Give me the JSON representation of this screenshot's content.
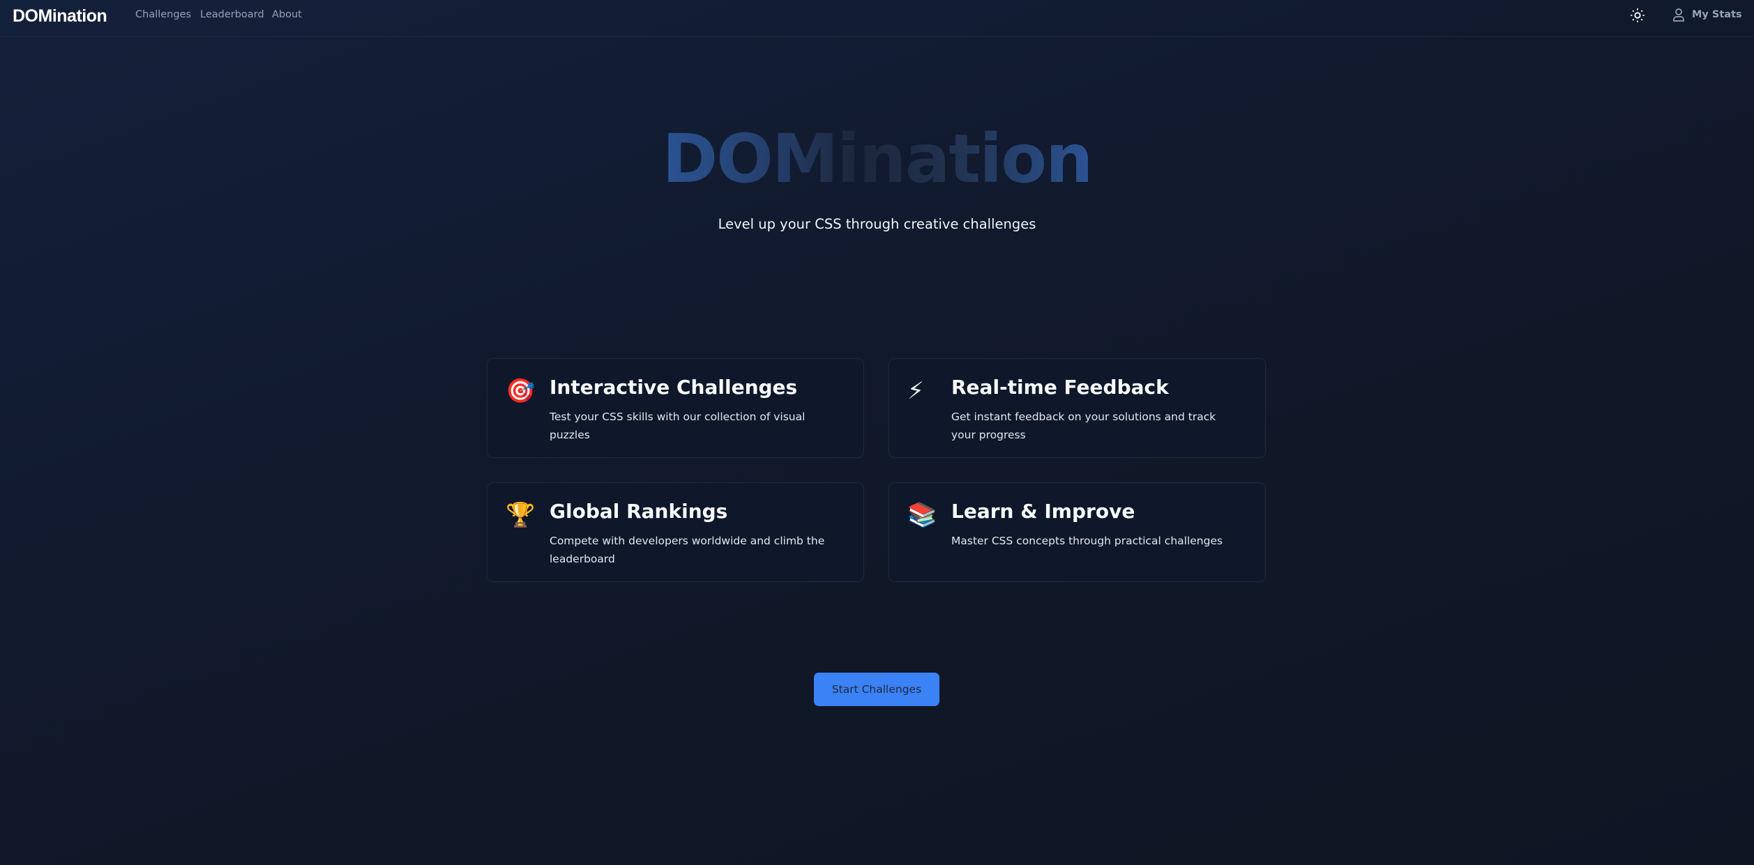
{
  "nav": {
    "logo": "DOMination",
    "links": [
      "Challenges",
      "Leaderboard",
      "About"
    ],
    "theme_toggle_icon": "sun-icon",
    "stats_icon": "user-icon",
    "stats_label": "My Stats"
  },
  "hero": {
    "title": "DOMination",
    "subtitle": "Level up your CSS through creative challenges"
  },
  "features": [
    {
      "icon": "🎯",
      "icon_name": "target-icon",
      "title": "Interactive Challenges",
      "desc": "Test your CSS skills with our collection of visual puzzles"
    },
    {
      "icon": "⚡",
      "icon_name": "lightning-icon",
      "title": "Real-time Feedback",
      "desc": "Get instant feedback on your solutions and track your progress"
    },
    {
      "icon": "🏆",
      "icon_name": "trophy-icon",
      "title": "Global Rankings",
      "desc": "Compete with developers worldwide and climb the leaderboard"
    },
    {
      "icon": "📚",
      "icon_name": "books-icon",
      "title": "Learn & Improve",
      "desc": "Master CSS concepts through practical challenges"
    }
  ],
  "cta": {
    "label": "Start Challenges"
  },
  "colors": {
    "accent": "#3b82f6",
    "background": "#111827",
    "card": "#0f172a",
    "border": "#1e293b"
  }
}
